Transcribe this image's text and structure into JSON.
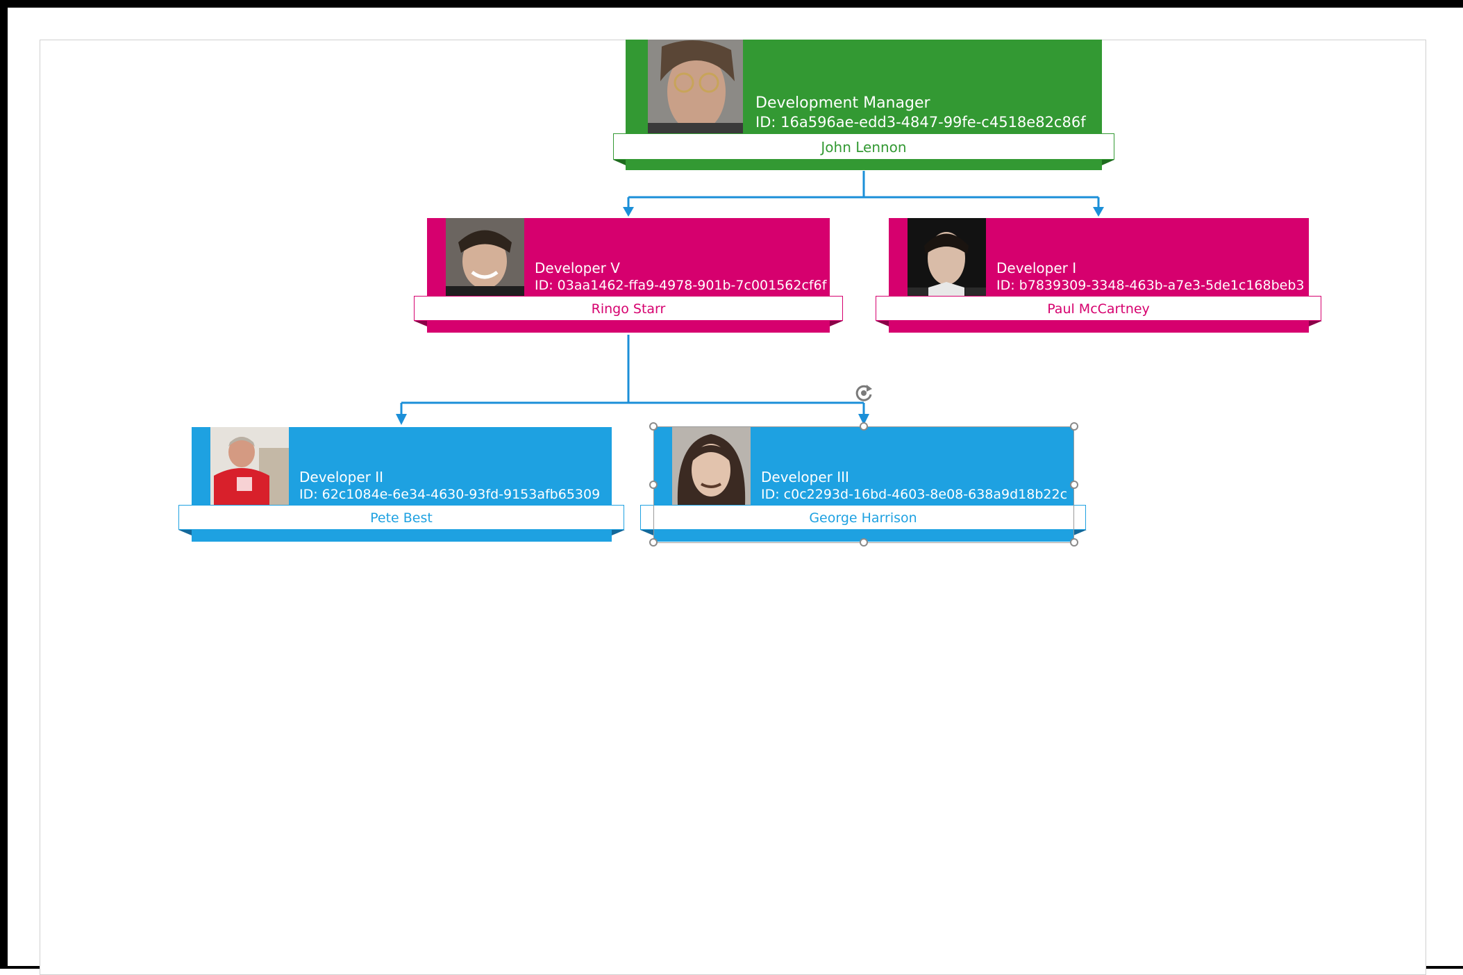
{
  "colors": {
    "manager": "#339933",
    "developer_magenta": "#d6006e",
    "developer_blue": "#1ea1e1",
    "connector": "#1b8fd8"
  },
  "nodes": {
    "john": {
      "role": "Development Manager",
      "id": "ID: 16a596ae-edd3-4847-99fe-c4518e82c86f",
      "name": "John Lennon"
    },
    "ringo": {
      "role": "Developer V",
      "id": "ID: 03aa1462-ffa9-4978-901b-7c001562cf6f",
      "name": "Ringo Starr"
    },
    "paul": {
      "role": "Developer I",
      "id": "ID: b7839309-3348-463b-a7e3-5de1c168beb3",
      "name": "Paul McCartney"
    },
    "pete": {
      "role": "Developer II",
      "id": "ID: 62c1084e-6e34-4630-93fd-9153afb65309",
      "name": "Pete Best"
    },
    "george": {
      "role": "Developer III",
      "id": "ID: c0c2293d-16bd-4603-8e08-638a9d18b22c",
      "name": "George Harrison"
    }
  },
  "selection": {
    "selected_node": "George Harrison",
    "rotate_icon": "rotate-handle-icon"
  }
}
